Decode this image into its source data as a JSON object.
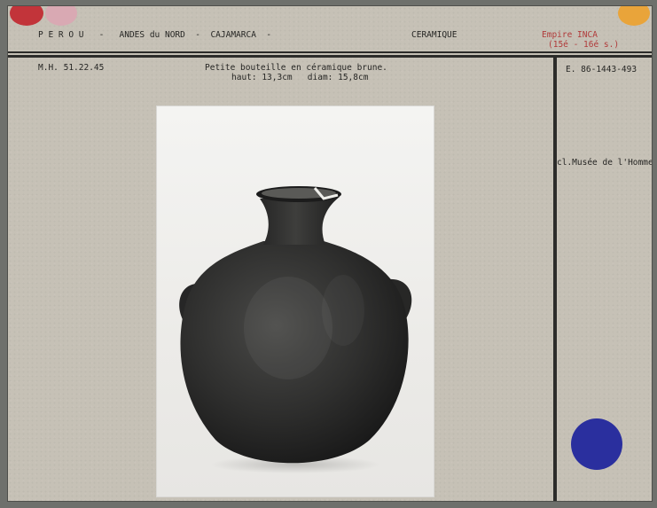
{
  "header": {
    "location": "P E R O U   -   ANDES du NORD  -  CAJAMARCA  -",
    "category": "CERAMIQUE",
    "culture_line1": "Empire INCA",
    "culture_line2": "(15é - 16é s.)"
  },
  "record": {
    "museum_number": "M.H. 51.22.45",
    "description_line1": "Petite bouteille en céramique brune.",
    "description_line2": "haut: 13,3cm   diam: 15,8cm",
    "photo_number": "E. 86-1443-493",
    "credit": "cl.Musée de l'Homme"
  },
  "colors": {
    "card": "#c6c1b6",
    "red_dot": "#c2343a",
    "pink_dot": "#d9a9b3",
    "orange_dot": "#e9a43a",
    "blue_dot": "#2a2f9e",
    "culture_text": "#b03a3a"
  },
  "photo": {
    "subject": "ceramic-bottle-with-two-lug-handles"
  }
}
